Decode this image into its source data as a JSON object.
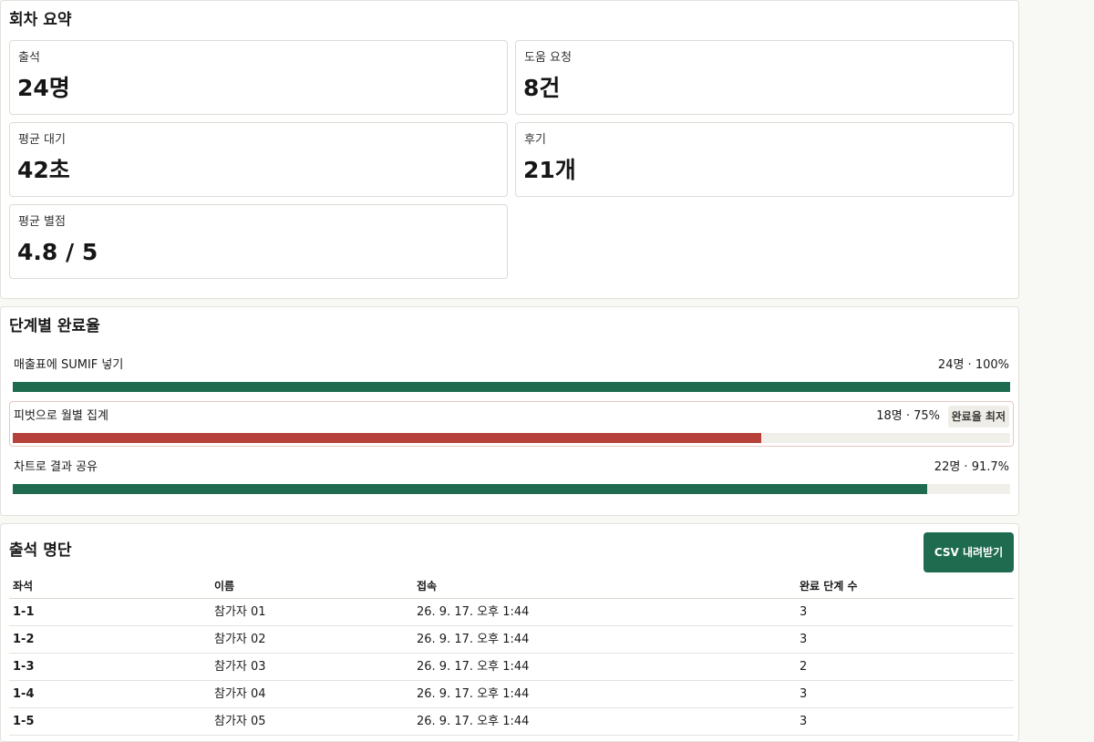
{
  "summary": {
    "title": "회차 요약",
    "stats": [
      {
        "label": "출석",
        "value": "24명"
      },
      {
        "label": "도움 요청",
        "value": "8건"
      },
      {
        "label": "평균 대기",
        "value": "42초"
      },
      {
        "label": "후기",
        "value": "21개"
      },
      {
        "label": "평균 별점",
        "value": "4.8 / 5"
      }
    ]
  },
  "steps": {
    "title": "단계별 완료율",
    "items": [
      {
        "name": "매출표에 SUMIF 넣기",
        "stat": "24명 · 100%",
        "percent": 100,
        "color": "#1e6b50",
        "badge": ""
      },
      {
        "name": "피벗으로 월별 집계",
        "stat": "18명 · 75%",
        "percent": 75,
        "color": "#b5413a",
        "badge": "완료율 최저"
      },
      {
        "name": "차트로 결과 공유",
        "stat": "22명 · 91.7%",
        "percent": 91.7,
        "color": "#1e6b50",
        "badge": ""
      }
    ]
  },
  "attendance": {
    "title": "출석 명단",
    "csv_label": "CSV 내려받기",
    "columns": [
      "좌석",
      "이름",
      "접속",
      "완료 단계 수"
    ],
    "rows": [
      [
        "1-1",
        "참가자 01",
        "26. 9. 17. 오후 1:44",
        "3"
      ],
      [
        "1-2",
        "참가자 02",
        "26. 9. 17. 오후 1:44",
        "3"
      ],
      [
        "1-3",
        "참가자 03",
        "26. 9. 17. 오후 1:44",
        "2"
      ],
      [
        "1-4",
        "참가자 04",
        "26. 9. 17. 오후 1:44",
        "3"
      ],
      [
        "1-5",
        "참가자 05",
        "26. 9. 17. 오후 1:44",
        "3"
      ]
    ]
  }
}
